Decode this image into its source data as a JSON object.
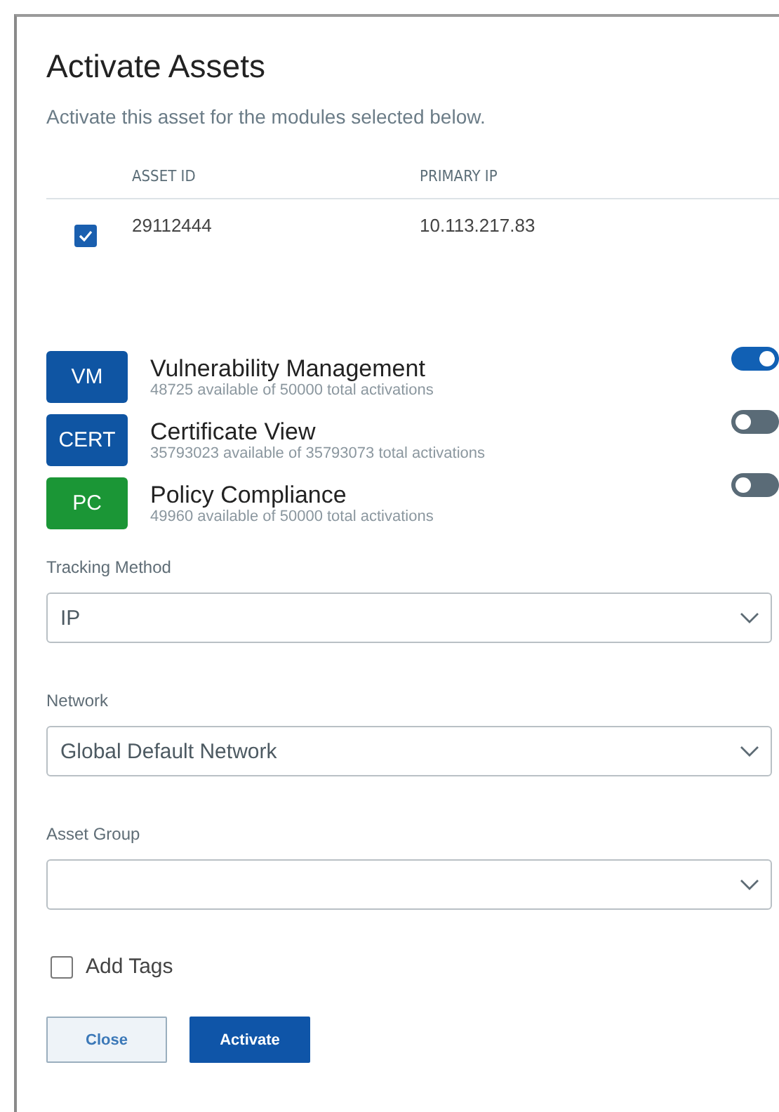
{
  "dialog": {
    "title": "Activate Assets",
    "subtitle": "Activate this asset for the modules selected below."
  },
  "table": {
    "columns": [
      "ASSET ID",
      "PRIMARY IP"
    ],
    "rows": [
      {
        "checked": true,
        "cells": [
          "29112444",
          "10.113.217.83"
        ]
      }
    ]
  },
  "modules": [
    {
      "badge": "VM",
      "color": "#0f55a3",
      "name": "Vulnerability Management",
      "availability": "48725 available of 50000 total activations",
      "on": true
    },
    {
      "badge": "CERT",
      "color": "#0f55a3",
      "name": "Certificate View",
      "availability": "35793023 available of 35793073 total activations",
      "on": false
    },
    {
      "badge": "PC",
      "color": "#1b9636",
      "name": "Policy Compliance",
      "availability": "49960 available of 50000 total activations",
      "on": false
    }
  ],
  "fields": [
    {
      "label": "Tracking Method",
      "value": "IP"
    },
    {
      "label": "Network",
      "value": "Global Default Network"
    },
    {
      "label": "Asset Group"
    }
  ],
  "add_tags": {
    "label": "Add Tags",
    "checked": false
  },
  "buttons": [
    {
      "label": "Close",
      "kind": "secondary"
    },
    {
      "label": "Activate",
      "kind": "primary"
    }
  ]
}
